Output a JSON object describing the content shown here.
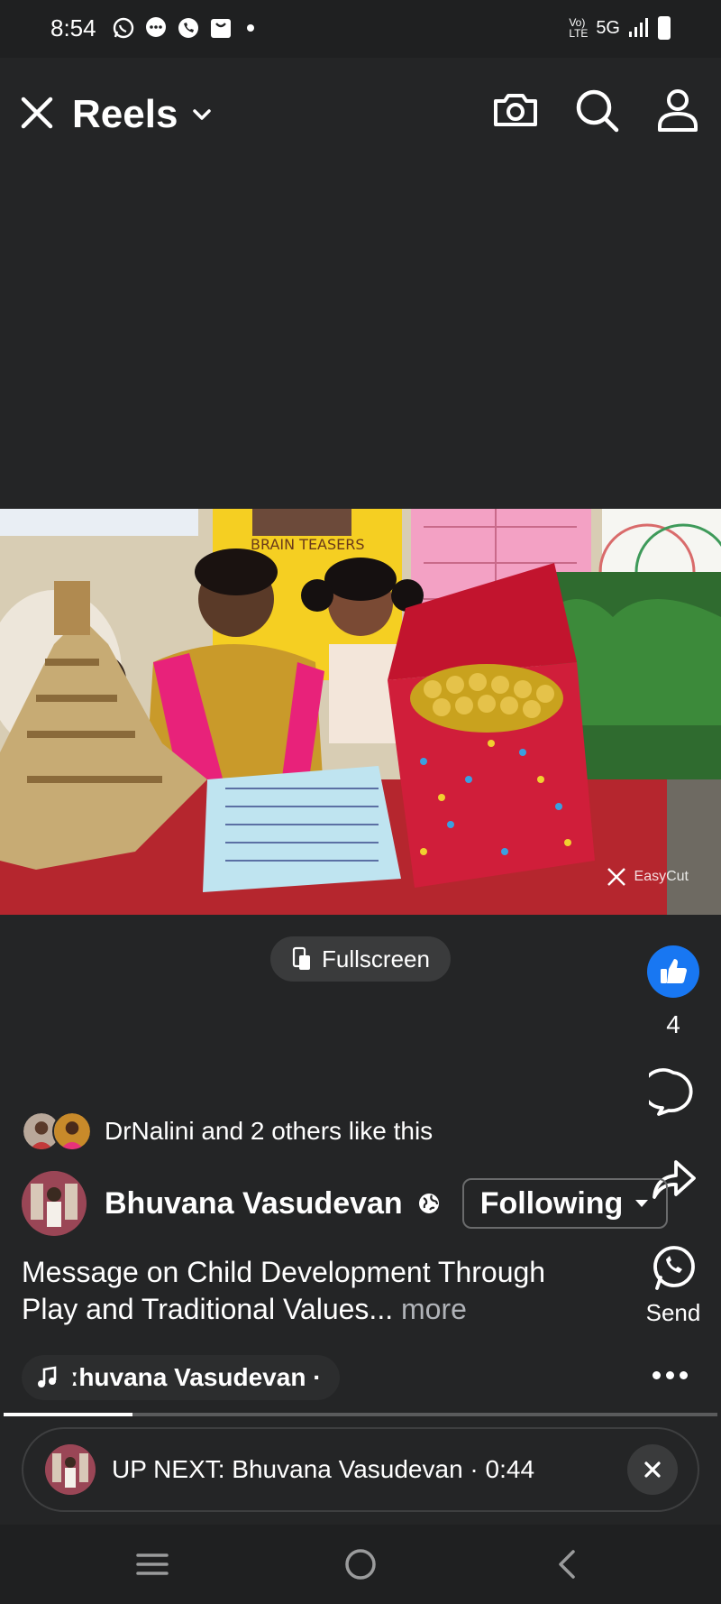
{
  "status_bar": {
    "time": "8:54",
    "network": "5G",
    "volte": "Vo) LTE"
  },
  "header": {
    "title": "Reels"
  },
  "video": {
    "watermark": "EasyCut",
    "poster_title": "BRAIN TEASERS"
  },
  "fullscreen_label": "Fullscreen",
  "rail": {
    "like_count": "4",
    "send_label": "Send"
  },
  "likes_summary": "DrNalini and 2 others like this",
  "author": {
    "name": "Bhuvana Vasudevan",
    "follow_label": "Following"
  },
  "caption": {
    "text": "Message on Child Development Through Play and Traditional Values...",
    "more": "more"
  },
  "audio": {
    "label": "ːhuvana Vasudevan ·"
  },
  "progress": 0.18,
  "up_next": {
    "label": "UP NEXT: Bhuvana Vasudevan · 0:44"
  },
  "colors": {
    "background": "#242526",
    "like_blue": "#1877f2"
  }
}
